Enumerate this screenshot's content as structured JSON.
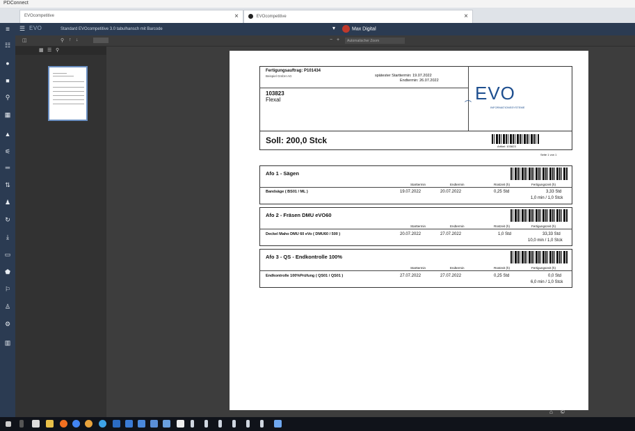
{
  "window": {
    "title": "PDConnect"
  },
  "browser": {
    "tabs": [
      {
        "label": "EVOcompetitive",
        "active": false
      },
      {
        "label": "EVOcompetitive",
        "active": true
      }
    ]
  },
  "header": {
    "logo": "EVO",
    "path": "Standard  EVOcompetitive 3.0 tabulhansch mit Barcode",
    "user": "Max Digital"
  },
  "viewer": {
    "zoom_label": "Automatischer Zoom"
  },
  "doc": {
    "title": "Fertigungsauftrag: P101434",
    "company": "Beispiel GmbH AG",
    "start_label": "spätester Starttermin: 19.07.2022",
    "end_label": "Endtermin: 26.07.2022",
    "article_no": "103823",
    "article_name": "Flexal",
    "evo_logo": "EVO",
    "evo_sub": "INFORMATIONSSYSTEME",
    "soll": "Soll: 200,0 Stck",
    "article_code": "Artikel: 103823",
    "page_info": "Seite 1 von 1",
    "col_headers": [
      "Starttermin",
      "Endtermin",
      "Rüstzeit (h)",
      "Fertigungszeit (h)"
    ],
    "ops": [
      {
        "title": "Afo 1 - Sägen",
        "machine": "Bandsäge ( BS01 / ML )",
        "start": "19.07.2022",
        "end": "20.07.2022",
        "setup": "0,25 Std",
        "time": "3,33 Std",
        "rate": "1,0 min / 1,0 Stck"
      },
      {
        "title": "Afo 2 - Fräsen DMU eVO60",
        "machine": "Deckel Maho DMU 60 eVo ( DMU60 / 500 )",
        "start": "20.07.2022",
        "end": "27.07.2022",
        "setup": "1,0 Std",
        "time": "33,33 Std",
        "rate": "10,0 min / 1,0 Stck"
      },
      {
        "title": "Afo 3 - QS - Endkontrolle 100%",
        "machine": "Endkontrolle 100%Prüfung ( QS01 / QS01 )",
        "start": "27.07.2022",
        "end": "27.07.2022",
        "setup": "0,25 Std",
        "time": "0,0 Std",
        "rate": "6,0 min / 1,0 Stck"
      }
    ]
  }
}
